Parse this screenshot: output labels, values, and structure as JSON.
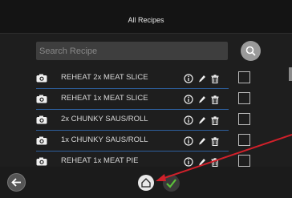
{
  "header": {
    "title": "All Recipes"
  },
  "search": {
    "placeholder": "Search Recipe",
    "button_icon": "search-icon"
  },
  "recipes": [
    {
      "label": "REHEAT 2x MEAT SLICE",
      "checked": false
    },
    {
      "label": "REHEAT 1x MEAT SLICE",
      "checked": false
    },
    {
      "label": "2x CHUNKY SAUS/ROLL",
      "checked": false
    },
    {
      "label": "1x CHUNKY SAUS/ROLL",
      "checked": false
    },
    {
      "label": "REHEAT 1x MEAT PIE",
      "checked": false
    }
  ],
  "row_icons": [
    "camera-icon",
    "info-icon",
    "pencil-icon",
    "trash-icon"
  ],
  "footer": {
    "back_icon": "back-arrow-icon",
    "home_icon": "home-icon",
    "confirm_icon": "checkmark-icon"
  },
  "colors": {
    "accent_line": "#2e5f9e",
    "annotation_arrow": "#d0202a",
    "confirm_green": "#5cc13a"
  }
}
